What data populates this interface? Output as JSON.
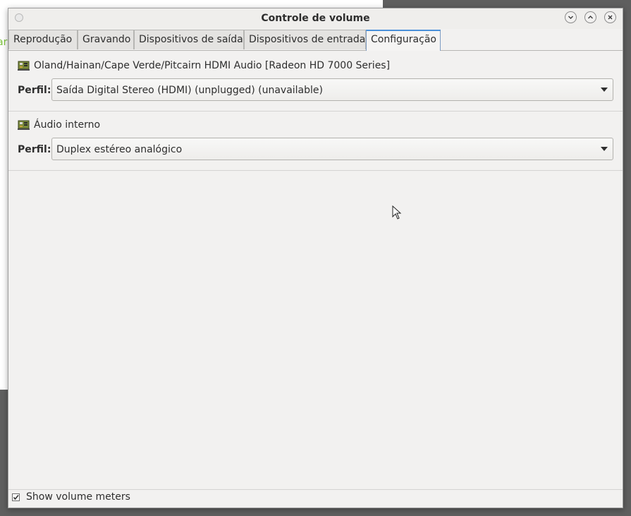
{
  "background_window": {
    "partial_text": "ar"
  },
  "window": {
    "title": "Controle de volume"
  },
  "tabs": [
    {
      "label": "Reprodução",
      "active": false
    },
    {
      "label": "Gravando",
      "active": false
    },
    {
      "label": "Dispositivos de saída",
      "active": false
    },
    {
      "label": "Dispositivos de entrada",
      "active": false
    },
    {
      "label": "Configuração",
      "active": true
    }
  ],
  "cards": [
    {
      "icon": "sound-card-icon",
      "title": "Oland/Hainan/Cape Verde/Pitcairn HDMI Audio [Radeon HD 7000 Series]",
      "profile_label": "Perfil:",
      "profile_value": "Saída Digital Stereo (HDMI) (unplugged) (unavailable)"
    },
    {
      "icon": "sound-card-icon",
      "title": "Áudio interno",
      "profile_label": "Perfil:",
      "profile_value": "Duplex estéreo analógico"
    }
  ],
  "footer": {
    "show_volume_meters_label": "Show volume meters",
    "show_volume_meters_checked": true
  },
  "colors": {
    "accent": "#4a90d9",
    "window_bg": "#f2f1f0",
    "desktop_bg": "#5f5f5f"
  }
}
